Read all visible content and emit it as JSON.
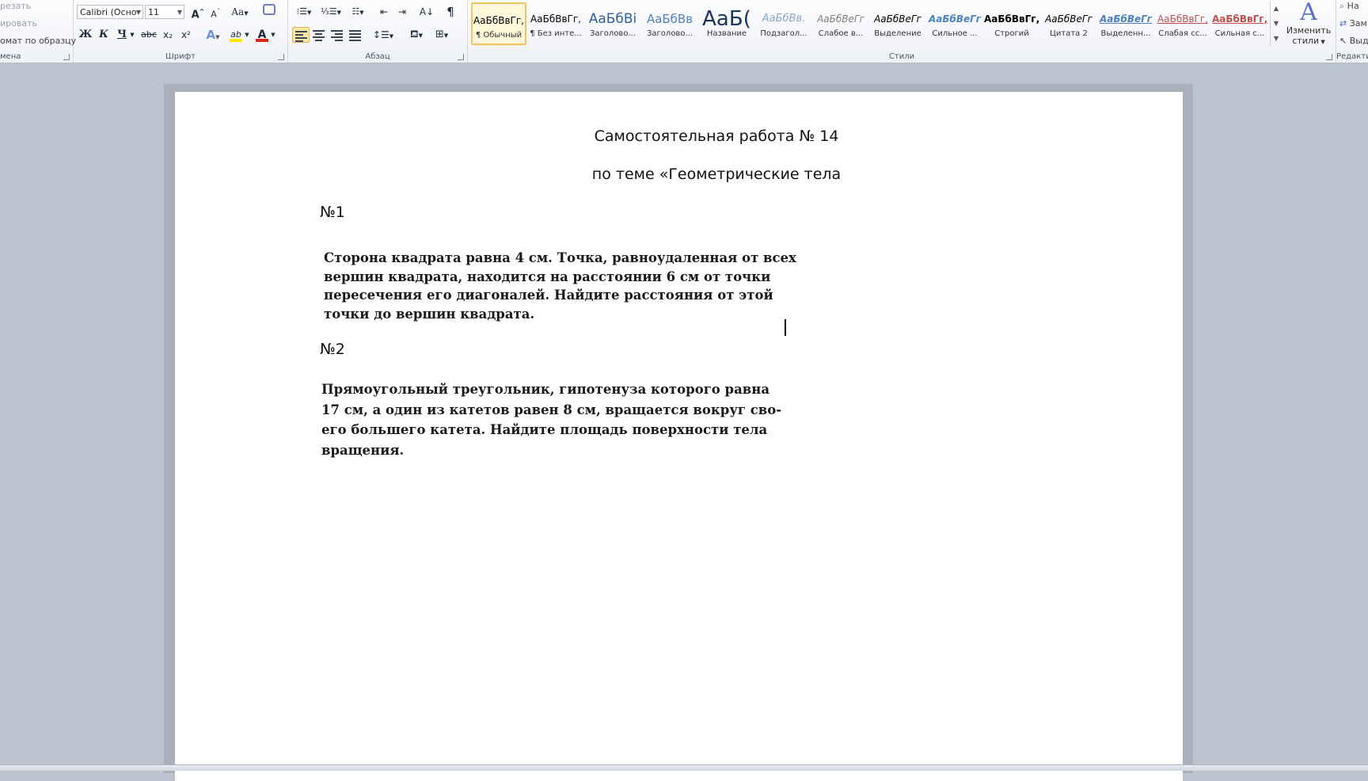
{
  "clipboard": {
    "cut": "резать",
    "copy": "ировать",
    "format_painter": "омат по образцу",
    "group": "мена"
  },
  "font": {
    "name": "Calibri (Осно",
    "size": "11",
    "group": "Шрифт",
    "grow": "A",
    "shrink": "A",
    "case": "Aa",
    "bold": "Ж",
    "italic": "К",
    "underline": "Ч",
    "strike": "abc",
    "sub": "x₂",
    "sup": "x²",
    "effects": "A",
    "highlight": "ab",
    "color": "A",
    "highlight_color": "#ffe600",
    "font_color": "#d9261c"
  },
  "paragraph": {
    "group": "Абзац",
    "pilcrow": "¶"
  },
  "styles": {
    "group": "Стили",
    "items": [
      {
        "sample": "АаБбВвГг,",
        "name": "¶ Обычный"
      },
      {
        "sample": "АаБбВвГг,",
        "name": "¶ Без инте..."
      },
      {
        "sample": "АаБбВі",
        "name": "Заголово..."
      },
      {
        "sample": "АаБбВв",
        "name": "Заголово..."
      },
      {
        "sample": "АаБ(",
        "name": "Название"
      },
      {
        "sample": "АаБбВв.",
        "name": "Подзагол..."
      },
      {
        "sample": "АаБбВеГг",
        "name": "Слабое в..."
      },
      {
        "sample": "АаБбВеГг",
        "name": "Выделение"
      },
      {
        "sample": "АаБбВеГг",
        "name": "Сильное ..."
      },
      {
        "sample": "АаБбВвГг,",
        "name": "Строгий"
      },
      {
        "sample": "АаБбВеГг",
        "name": "Цитата 2"
      },
      {
        "sample": "АаБбВеГг",
        "name": "Выделенн..."
      },
      {
        "sample": "АаБбВвГг,",
        "name": "Слабая сс..."
      },
      {
        "sample": "АаБбВвГг,",
        "name": "Сильная с..."
      }
    ],
    "change_label_1": "Изменить",
    "change_label_2": "стили",
    "change_icon": "A"
  },
  "editing": {
    "group": "Редакти",
    "find": "На",
    "replace": "Зам",
    "select": "Выд"
  },
  "document": {
    "title_1": "Самостоятельная работа № 14",
    "title_2": "по теме «Геометрические тела",
    "task1_label": "№1",
    "task1_lines": [
      "Сторона квадрата равна 4 см. Точка, равноудаленная от всех",
      "вершин квадрата, находится на расстоянии 6 см от точки",
      "пересечения его диагоналей. Найдите расстояния от этой",
      "точки до вершин квадрата."
    ],
    "task2_label": "№2",
    "task2_lines": [
      "Прямоугольный треугольник, гипотенуза которого равна",
      "17 см, а один из катетов равен 8 см, вращается вокруг сво-",
      "его большего катета. Найдите площадь поверхности тела",
      "вращения."
    ]
  }
}
